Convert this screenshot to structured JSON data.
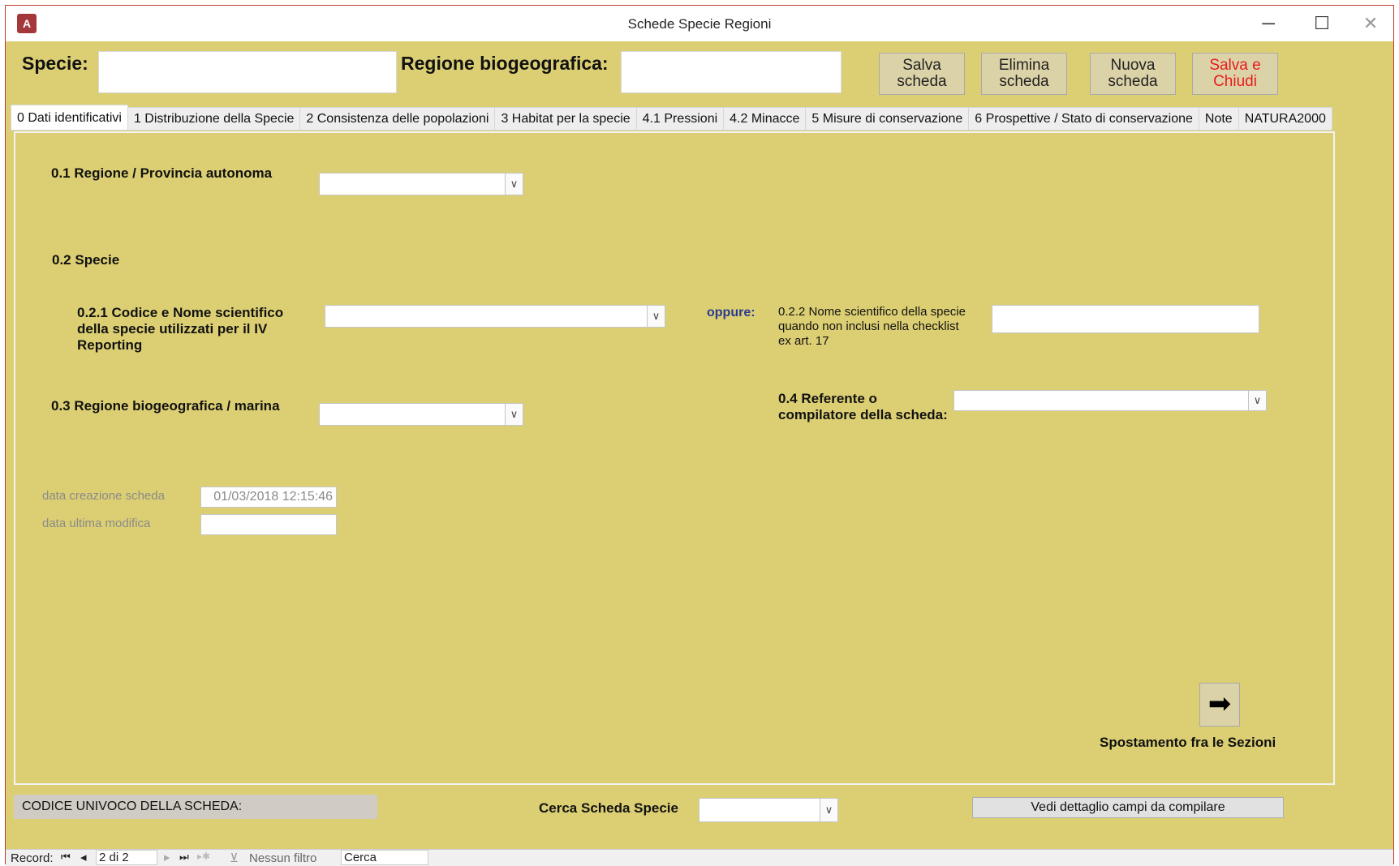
{
  "window": {
    "title": "Schede Specie Regioni",
    "minimize_icon": "─",
    "maximize_icon": "☐",
    "close_icon": "✕"
  },
  "header": {
    "specie_label": "Specie:",
    "regione_label": "Regione biogeografica:",
    "buttons": {
      "salva_l1": "Salva",
      "salva_l2": "scheda",
      "elimina_l1": "Elimina",
      "elimina_l2": "scheda",
      "nuova_l1": "Nuova",
      "nuova_l2": "scheda",
      "chiudi_l1": "Salva e",
      "chiudi_l2": "Chiudi",
      "chiudi_color": "#e81b1b"
    }
  },
  "tabs": [
    "0 Dati identificativi",
    "1 Distribuzione della Specie",
    "2 Consistenza delle popolazioni",
    "3 Habitat per la specie",
    "4.1 Pressioni",
    "4.2 Minacce",
    "5 Misure di conservazione",
    "6 Prospettive / Stato di conservazione",
    "Note",
    "NATURA2000"
  ],
  "form": {
    "q01": "0.1 Regione / Provincia autonoma",
    "q02": "0.2 Specie",
    "q021_l1": "0.2.1 Codice e Nome scientifico",
    "q021_l2": "della specie utilizzati per il IV",
    "q021_l3": "Reporting",
    "oppure": "oppure:",
    "oppure_color": "#2b3a8f",
    "q022_l1": "0.2.2 Nome scientifico della specie",
    "q022_l2": "quando non inclusi nella checklist",
    "q022_l3": "ex art. 17",
    "q03": "0.3 Regione biogeografica / marina",
    "q04_l1": "0.4 Referente o",
    "q04_l2": "compilatore della scheda:",
    "data_creazione_label": "data creazione scheda",
    "data_creazione_value": "01/03/2018 12:15:46",
    "data_modifica_label": "data ultima modifica",
    "data_modifica_value": "",
    "nav_arrow": "➡",
    "nav_label": "Spostamento fra le Sezioni"
  },
  "footer": {
    "codice_label": "CODICE UNIVOCO DELLA SCHEDA:",
    "cerca_label": "Cerca Scheda Specie",
    "dettaglio_button": "Vedi dettaglio campi da compilare"
  },
  "statusbar": {
    "record_label": "Record:",
    "first_icon": "⏮",
    "prev_icon": "◂",
    "record_value": "2 di 2",
    "next_icon": "▸",
    "last_icon": "⏭",
    "new_icon": "▸✱",
    "filter_icon": "⊻",
    "filter_label": "Nessun filtro",
    "search_value": "Cerca"
  }
}
